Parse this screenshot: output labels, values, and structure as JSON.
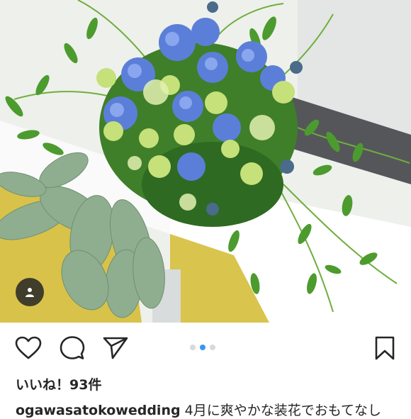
{
  "post": {
    "image_alt": "Blue and green wedding bouquet with hydrangeas and trailing vines",
    "carousel": {
      "count": 3,
      "active_index": 1
    },
    "likes_text": "いいね！93件",
    "caption": {
      "username": "ogawasatokowedding",
      "text": " 4月に爽やかな装花でおもてなし"
    }
  },
  "icons": {
    "like": "heart-icon",
    "comment": "comment-icon",
    "share": "send-icon",
    "save": "bookmark-icon",
    "tag": "user-tag-icon"
  },
  "colors": {
    "accent": "#3897f0",
    "text": "#262626",
    "dot_inactive": "#d9d9d9"
  }
}
